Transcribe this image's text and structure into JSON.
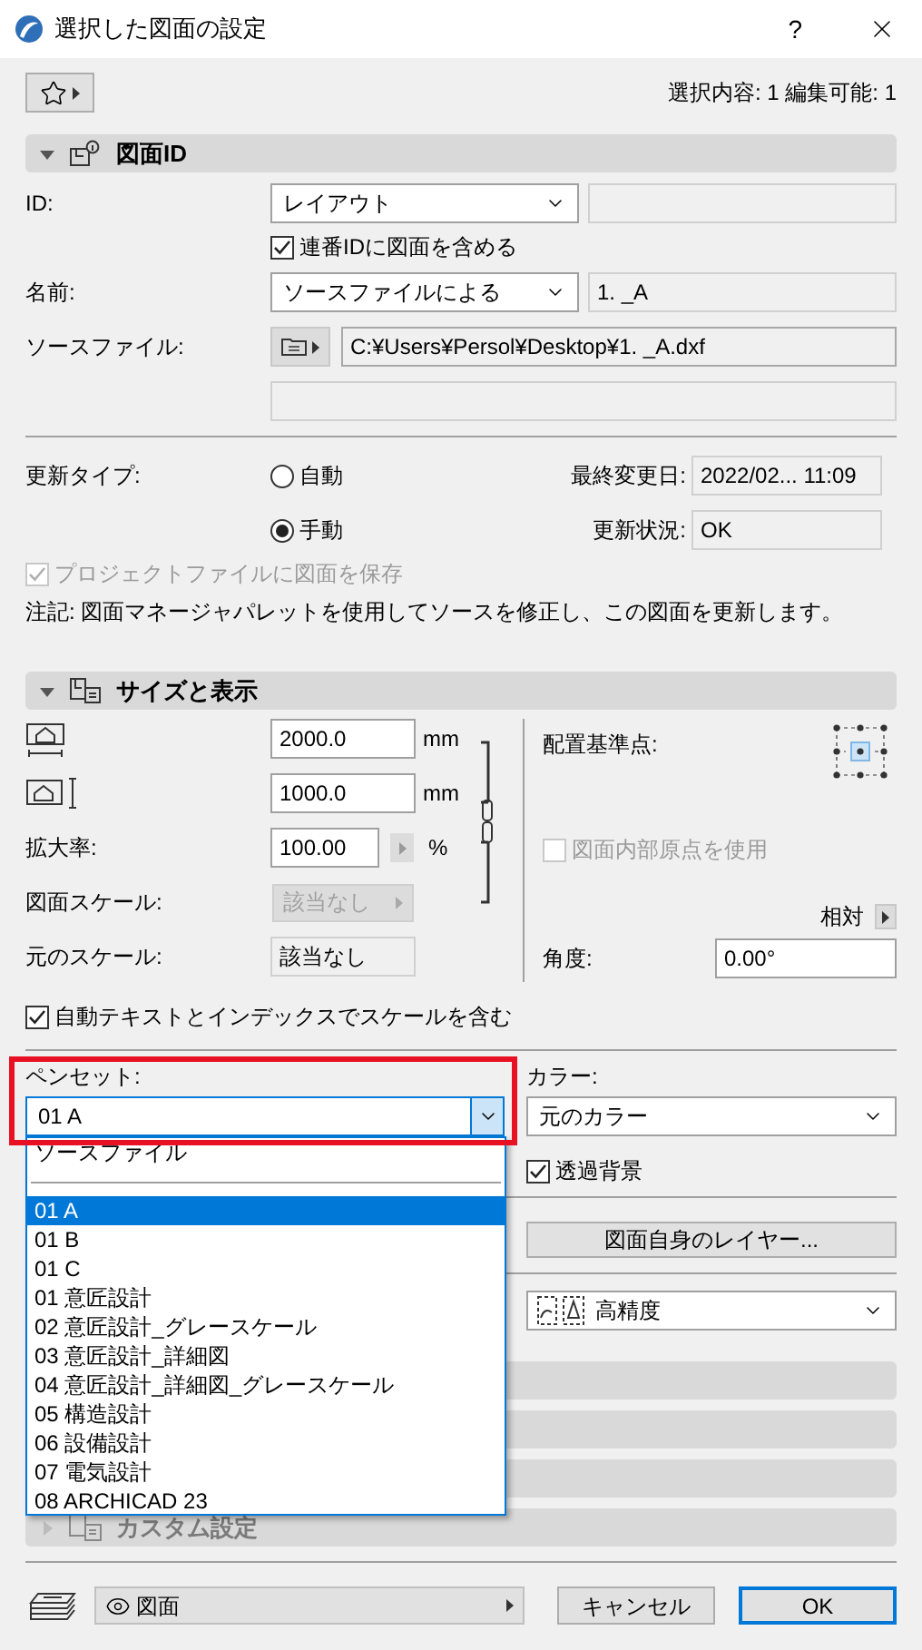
{
  "window": {
    "title": "選択した図面の設定",
    "help": "?"
  },
  "selection_info": "選択内容: 1 編集可能: 1",
  "drawing_id": {
    "title": "図面ID",
    "expanded": true,
    "id": {
      "label": "ID:",
      "value": "レイアウト"
    },
    "include_in_numbering": {
      "label": "連番IDに図面を含める",
      "checked": true
    },
    "name": {
      "label": "名前:",
      "value": "ソースファイルによる",
      "text": "1. _A"
    },
    "source": {
      "label": "ソースファイル:",
      "path": "C:¥Users¥Persol¥Desktop¥1. _A.dxf"
    },
    "update_type": {
      "label": "更新タイプ:",
      "options": [
        {
          "label": "自動",
          "selected": false
        },
        {
          "label": "手動",
          "selected": true
        }
      ]
    },
    "last_modified": {
      "label": "最終変更日:",
      "value": "2022/02... 11:09"
    },
    "update_status": {
      "label": "更新状況:",
      "value": "OK"
    },
    "save_in_project": {
      "label": "プロジェクトファイルに図面を保存",
      "checked": true,
      "disabled": true
    },
    "note": "注記: 図面マネージャパレットを使用してソースを修正し、この図面を更新します。"
  },
  "size_display": {
    "title": "サイズと表示",
    "expanded": true,
    "width": {
      "value": "2000.0",
      "unit": "mm"
    },
    "height": {
      "value": "1000.0",
      "unit": "mm"
    },
    "magnification": {
      "label": "拡大率:",
      "value": "100.00",
      "unit": "%"
    },
    "drawing_scale": {
      "label": "図面スケール:",
      "value": "該当なし",
      "disabled": true
    },
    "original_scale": {
      "label": "元のスケール:",
      "value": "該当なし"
    },
    "anchor": {
      "label": "配置基準点:"
    },
    "use_origin": {
      "label": "図面内部原点を使用",
      "checked": false,
      "disabled": true
    },
    "relative": "相対",
    "angle": {
      "label": "角度:",
      "value": "0.00°"
    },
    "include_scale": {
      "label": "自動テキストとインデックスでスケールを含む",
      "checked": true
    }
  },
  "pen_set": {
    "label": "ペンセット:",
    "value": "01 A",
    "options": [
      {
        "kind": "item",
        "label": "ソースファイル",
        "selected": false
      },
      {
        "kind": "separator"
      },
      {
        "kind": "item",
        "label": "01 A",
        "selected": true
      },
      {
        "kind": "item",
        "label": "01 B",
        "selected": false
      },
      {
        "kind": "item",
        "label": "01 C",
        "selected": false
      },
      {
        "kind": "item",
        "label": "01 意匠設計",
        "selected": false
      },
      {
        "kind": "item",
        "label": "02 意匠設計_グレースケール",
        "selected": false
      },
      {
        "kind": "item",
        "label": "03 意匠設計_詳細図",
        "selected": false
      },
      {
        "kind": "item",
        "label": "04 意匠設計_詳細図_グレースケール",
        "selected": false
      },
      {
        "kind": "item",
        "label": "05 構造設計",
        "selected": false
      },
      {
        "kind": "item",
        "label": "06 設備設計",
        "selected": false
      },
      {
        "kind": "item",
        "label": "07 電気設計",
        "selected": false
      },
      {
        "kind": "item",
        "label": "08 ARCHICAD 23",
        "selected": false
      }
    ]
  },
  "color": {
    "label": "カラー:",
    "value": "元のカラー"
  },
  "transparent": {
    "label": "透過背景",
    "checked": true
  },
  "layers_button": "図面自身のレイヤー...",
  "quality": "高精度",
  "custom_section": {
    "title": "カスタム設定",
    "expanded": false,
    "disabled": true
  },
  "footer": {
    "view": "図面",
    "cancel": "キャンセル",
    "ok": "OK"
  }
}
